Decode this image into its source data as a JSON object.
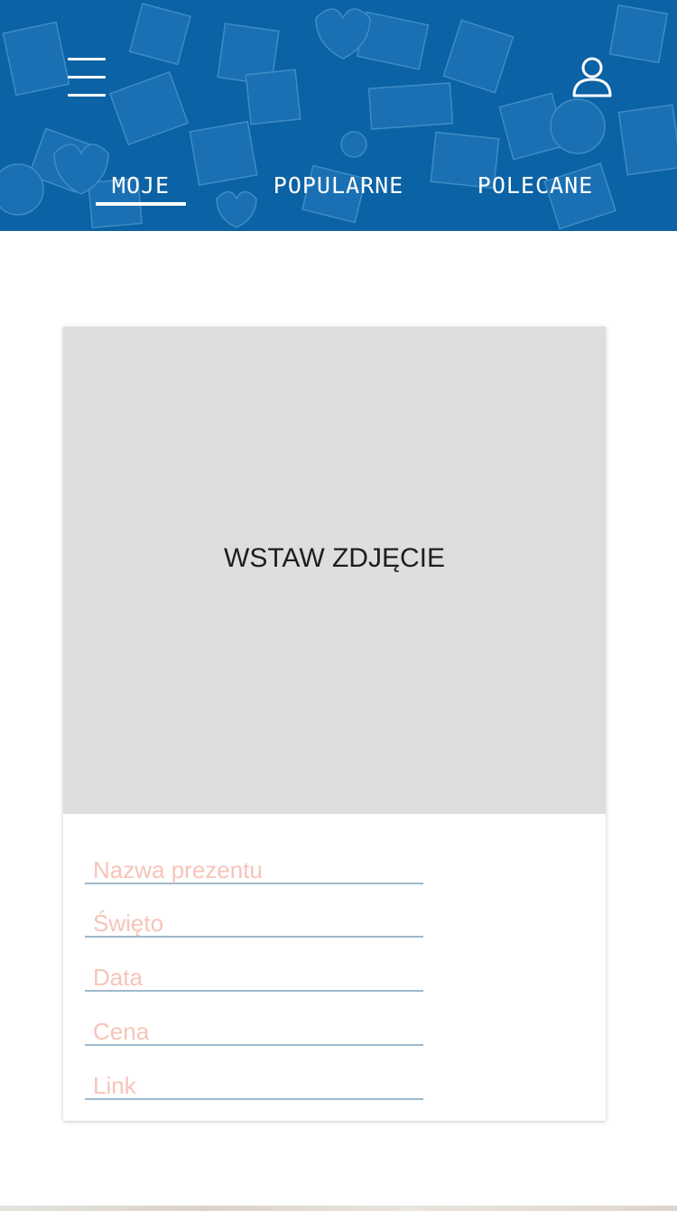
{
  "colors": {
    "header_bg": "#0b62a4",
    "tab_text": "#ffffff",
    "photo_bg": "#dedee0",
    "field_placeholder": "#f7c4b8",
    "field_underline": "#9fb9cc"
  },
  "header": {
    "menu_icon": "hamburger-menu-icon",
    "profile_icon": "user-profile-icon",
    "background_pattern": "gift-boxes-pattern"
  },
  "tabs": [
    {
      "label": "MOJE",
      "active": true
    },
    {
      "label": "POPULARNE",
      "active": false
    },
    {
      "label": "POLECANE",
      "active": false
    }
  ],
  "card": {
    "photo_label": "WSTAW ZDJĘCIE",
    "fields": [
      {
        "placeholder": "Nazwa prezentu"
      },
      {
        "placeholder": "Święto"
      },
      {
        "placeholder": "Data"
      },
      {
        "placeholder": "Cena"
      },
      {
        "placeholder": "Link"
      }
    ]
  }
}
